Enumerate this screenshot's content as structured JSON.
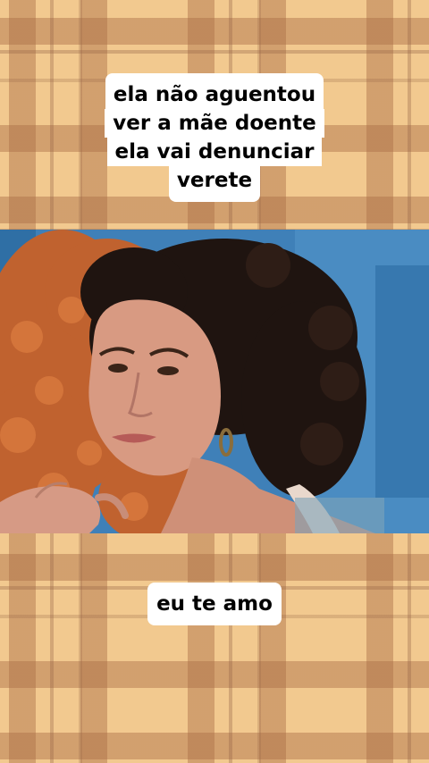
{
  "top_caption": {
    "lines": [
      "ela não aguentou",
      "ver a mãe doente",
      "ela vai denunciar",
      "verete"
    ]
  },
  "bottom_caption": {
    "text": "eu te amo"
  },
  "colors": {
    "plaid_base": "#f2c98f",
    "plaid_stripe": "#aa6e46",
    "caption_bg": "#ffffff",
    "caption_text": "#000000",
    "scene_background": "#3b7fb7"
  }
}
